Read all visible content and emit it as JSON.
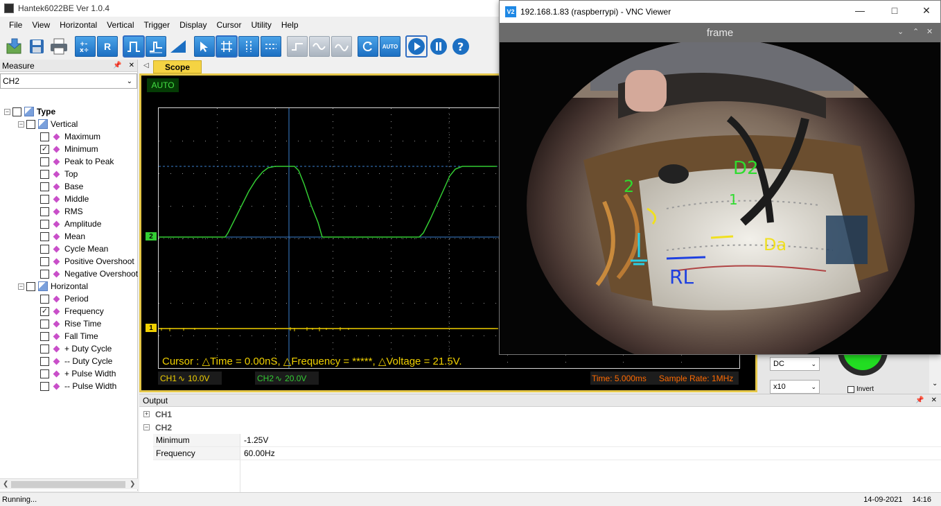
{
  "app": {
    "title": "Hantek6022BE Ver 1.0.4"
  },
  "menu": [
    "File",
    "View",
    "Horizontal",
    "Vertical",
    "Trigger",
    "Display",
    "Cursor",
    "Utility",
    "Help"
  ],
  "toolbar": {
    "auto_label": "AUTO",
    "r_label": "R",
    "help_label": "?"
  },
  "measure": {
    "title": "Measure",
    "pin": "↑",
    "close": "✕",
    "channel": "CH2",
    "type_label": "Type",
    "vertical_label": "Vertical",
    "horizontal_label": "Horizontal",
    "vertical_items": [
      {
        "label": "Maximum",
        "checked": false
      },
      {
        "label": "Minimum",
        "checked": true
      },
      {
        "label": "Peak to Peak",
        "checked": false
      },
      {
        "label": "Top",
        "checked": false
      },
      {
        "label": "Base",
        "checked": false
      },
      {
        "label": "Middle",
        "checked": false
      },
      {
        "label": "RMS",
        "checked": false
      },
      {
        "label": "Amplitude",
        "checked": false
      },
      {
        "label": "Mean",
        "checked": false
      },
      {
        "label": "Cycle Mean",
        "checked": false
      },
      {
        "label": "Positive Overshoot",
        "checked": false
      },
      {
        "label": "Negative Overshoot",
        "checked": false
      }
    ],
    "horizontal_items": [
      {
        "label": "Period",
        "checked": false
      },
      {
        "label": "Frequency",
        "checked": true
      },
      {
        "label": "Rise Time",
        "checked": false
      },
      {
        "label": "Fall Time",
        "checked": false
      },
      {
        "label": "+ Duty Cycle",
        "checked": false
      },
      {
        "label": "-- Duty Cycle",
        "checked": false
      },
      {
        "label": "+ Pulse Width",
        "checked": false
      },
      {
        "label": "-- Pulse Width",
        "checked": false
      }
    ]
  },
  "scope": {
    "tab_label": "Scope",
    "mode": "AUTO",
    "cursor_readout": "Cursor : △Time = 0.00nS, △Frequency = *****, △Voltage = 21.5V.",
    "ch1_label": "CH1",
    "ch1_scale": "10.0V",
    "ch2_label": "CH2",
    "ch2_scale": "20.0V",
    "time_label": "Time: 5.000ms",
    "sample_rate": "Sample Rate: 1MHz",
    "marker_ch1": "1",
    "marker_ch2": "2",
    "ch1_color": "#f0d000",
    "ch2_color": "#33cc33"
  },
  "right_panel": {
    "coupling": "DC",
    "probe": "x10",
    "invert_label": "Invert"
  },
  "output": {
    "title": "Output",
    "ch1": "CH1",
    "ch2": "CH2",
    "rows": [
      {
        "name": "Minimum",
        "value": "-1.25V"
      },
      {
        "name": "Frequency",
        "value": "60.00Hz"
      }
    ]
  },
  "status": {
    "text": "Running...",
    "date": "14-09-2021",
    "time": "14:16"
  },
  "vnc": {
    "title": "192.168.1.83 (raspberrypi) - VNC Viewer",
    "icon_label": "V2",
    "frame_label": "frame",
    "annotations": [
      "2",
      "D2",
      "1",
      "Da",
      "RL"
    ]
  }
}
